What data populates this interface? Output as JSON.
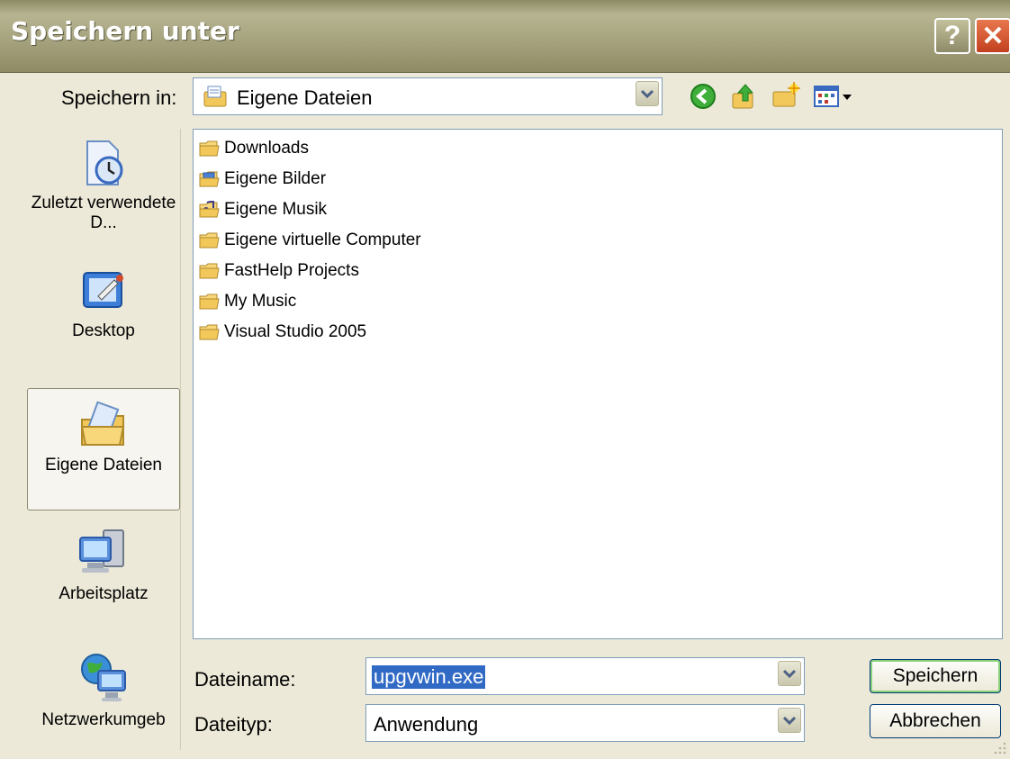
{
  "window": {
    "title": "Speichern unter",
    "help_symbol": "?",
    "close_symbol": "✕"
  },
  "toolbar": {
    "save_in_label": "Speichern in:",
    "save_in_value": "Eigene Dateien",
    "icons": [
      "back-icon",
      "up-folder-icon",
      "new-folder-icon",
      "view-menu-icon"
    ]
  },
  "places": [
    {
      "label": "Zuletzt verwendete D...",
      "icon": "recent-documents-icon"
    },
    {
      "label": "Desktop",
      "icon": "desktop-icon"
    },
    {
      "label": "Eigene Dateien",
      "icon": "my-documents-icon",
      "selected": true
    },
    {
      "label": "Arbeitsplatz",
      "icon": "my-computer-icon"
    },
    {
      "label": "Netzwerkumgeb",
      "icon": "network-icon"
    }
  ],
  "files": [
    {
      "name": "Downloads",
      "icon": "folder-icon"
    },
    {
      "name": "Eigene Bilder",
      "icon": "pictures-folder-icon"
    },
    {
      "name": "Eigene Musik",
      "icon": "music-folder-icon"
    },
    {
      "name": "Eigene virtuelle Computer",
      "icon": "folder-icon"
    },
    {
      "name": "FastHelp Projects",
      "icon": "folder-icon"
    },
    {
      "name": "My Music",
      "icon": "folder-icon"
    },
    {
      "name": "Visual Studio 2005",
      "icon": "folder-icon"
    }
  ],
  "footer": {
    "filename_label": "Dateiname:",
    "filename_value": "upgvwin.exe",
    "filetype_label": "Dateityp:",
    "filetype_value": "Anwendung",
    "save_button": "Speichern",
    "cancel_button": "Abbrechen"
  },
  "colors": {
    "title_bar": "#a6a37f",
    "window_bg": "#ECE9D8",
    "selection": "#316AC5",
    "close_button": "#d45a30"
  }
}
